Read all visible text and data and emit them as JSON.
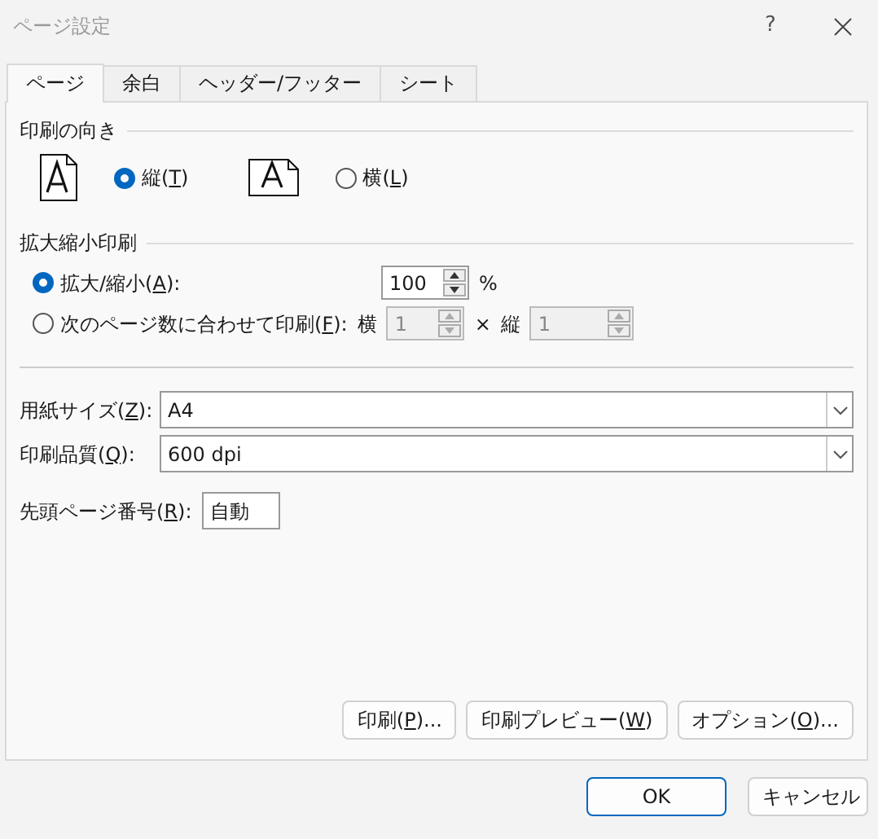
{
  "window": {
    "title": "ページ設定",
    "help": "?"
  },
  "tabs": [
    {
      "label": "ページ",
      "selected": true
    },
    {
      "label": "余白",
      "selected": false
    },
    {
      "label": "ヘッダー/フッター",
      "selected": false
    },
    {
      "label": "シート",
      "selected": false
    }
  ],
  "orientation": {
    "legend": "印刷の向き",
    "options": [
      {
        "kind": "portrait",
        "parts": [
          "縦(",
          "T",
          ")"
        ],
        "selected": true
      },
      {
        "kind": "landscape",
        "parts": [
          "横(",
          "L",
          ")"
        ],
        "selected": false
      }
    ]
  },
  "scaling": {
    "legend": "拡大縮小印刷",
    "options": [
      {
        "parts": [
          "拡大/縮小(",
          "A",
          "):"
        ],
        "selected": true
      },
      {
        "parts": [
          "次のページ数に合わせて印刷(",
          "F",
          "):"
        ],
        "selected": false
      }
    ],
    "percent": {
      "value": "100",
      "unit": "%",
      "disabled": false
    },
    "fit_wide": {
      "label": "横",
      "value": "1",
      "disabled": true
    },
    "times": "×",
    "fit_tall": {
      "label": "縦",
      "value": "1",
      "disabled": true
    }
  },
  "paper_size": {
    "parts": [
      "用紙サイズ(",
      "Z",
      "):"
    ],
    "value": "A4"
  },
  "print_quality": {
    "parts": [
      "印刷品質(",
      "Q",
      "):"
    ],
    "value": "600 dpi"
  },
  "first_page": {
    "parts": [
      "先頭ページ番号(",
      "R",
      "):"
    ],
    "value": "自動"
  },
  "tab_buttons": [
    {
      "parts": [
        "印刷(",
        "P",
        ")..."
      ]
    },
    {
      "parts": [
        "印刷プレビュー(",
        "W",
        ")"
      ]
    },
    {
      "parts": [
        "オプション(",
        "O",
        ")..."
      ]
    }
  ],
  "dialog_buttons": [
    {
      "label": "OK",
      "default": true
    },
    {
      "label": "キャンセル",
      "default": false
    }
  ]
}
